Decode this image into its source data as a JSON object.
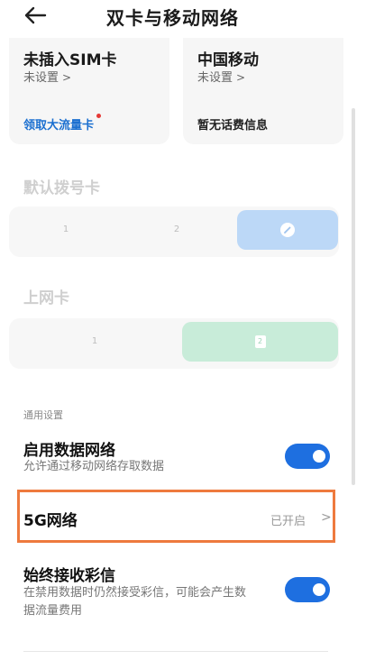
{
  "header": {
    "title": "双卡与移动网络"
  },
  "sim_cards": [
    {
      "name": "未插入SIM卡",
      "status": "未设置",
      "link": "领取大流量卡"
    },
    {
      "name": "中国移动",
      "status": "未设置",
      "info": "暂无话费信息"
    }
  ],
  "default_dial": {
    "title": "默认拨号卡",
    "options": [
      "1",
      "2"
    ]
  },
  "data_card": {
    "title": "上网卡",
    "options": [
      "1",
      "2"
    ]
  },
  "general": {
    "caption": "通用设置",
    "mobile_data": {
      "title": "启用数据网络",
      "desc": "允许通过移动网络存取数据",
      "enabled": true
    },
    "five_g": {
      "title": "5G网络",
      "value": "已开启"
    },
    "mms": {
      "title": "始终接收彩信",
      "desc_line1": "在禁用数据时仍然接受彩信，可能会产生数",
      "desc_line2": "据流量费用",
      "enabled": true
    }
  },
  "icons": {
    "back": "back-arrow-icon",
    "chevron": "chevron-right-icon",
    "pen": "pen-icon"
  },
  "colors": {
    "accent": "#1e6fe0",
    "link": "#1b6fd0",
    "highlight": "#ee7a3e",
    "dial_selected": "#bcd8f7",
    "data_selected": "#c8ecd9"
  }
}
